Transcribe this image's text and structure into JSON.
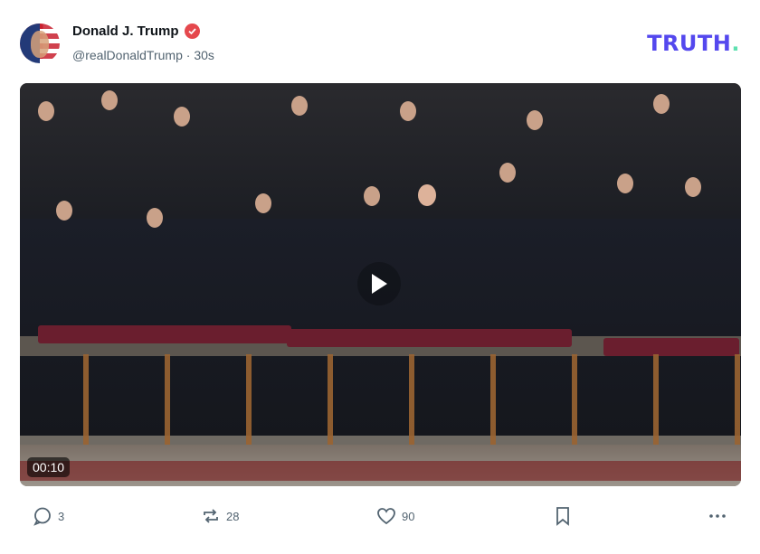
{
  "post": {
    "display_name": "Donald J. Trump",
    "handle": "@realDonaldTrump",
    "separator": "·",
    "age": "30s",
    "brand": {
      "name": "TRUTH",
      "dot": "."
    },
    "video": {
      "duration": "00:10"
    },
    "actions": {
      "replies": "3",
      "retruths": "28",
      "likes": "90"
    }
  },
  "colors": {
    "brand": "#5448ee",
    "brand_dot": "#5ee0b0",
    "verified": "#e5484d",
    "muted": "#536471"
  },
  "icons": [
    "verified-icon",
    "play-icon",
    "reply-icon",
    "retruth-icon",
    "like-icon",
    "bookmark-icon",
    "more-icon"
  ]
}
